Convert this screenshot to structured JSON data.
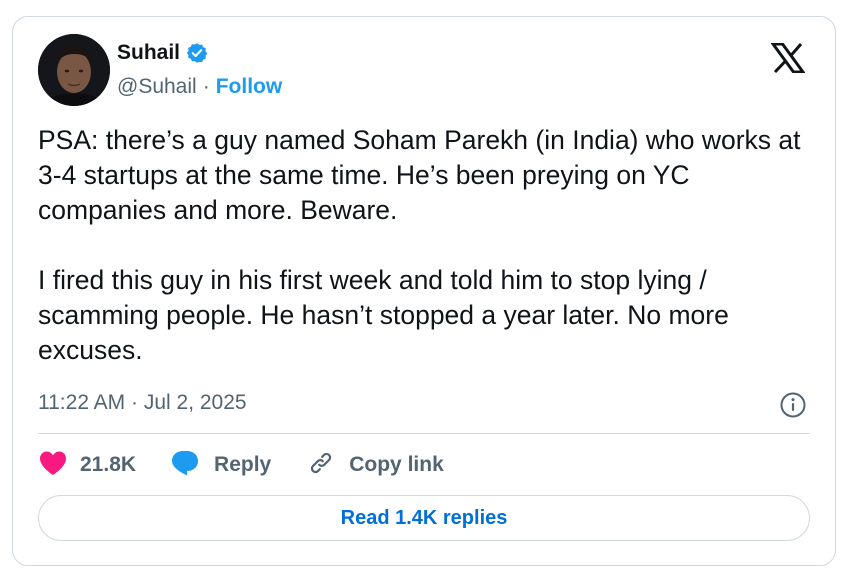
{
  "author": {
    "name": "Suhail",
    "handle": "@Suhail",
    "verified": true,
    "follow_label": "Follow",
    "separator": "·"
  },
  "tweet": {
    "paragraphs": [
      "PSA: there’s a guy named Soham Parekh (in India) who works at 3-4 startups at the same time. He’s been preying on YC companies and more. Beware.",
      "I fired this guy in his first week and told him to stop lying / scamming people. He hasn’t stopped a year later. No more excuses."
    ],
    "timestamp": "11:22 AM · Jul 2, 2025"
  },
  "actions": {
    "likes_count": "21.8K",
    "reply_label": "Reply",
    "copy_link_label": "Copy link"
  },
  "read_replies_label": "Read 1.4K replies",
  "icons": {
    "logo": "x-logo-icon",
    "verified": "verified-badge-icon",
    "info": "info-icon",
    "like": "heart-icon",
    "reply": "speech-bubble-icon",
    "copy": "link-icon"
  },
  "colors": {
    "accent": "#1d9bf0",
    "like": "#f91880",
    "muted": "#536471",
    "text": "#0f1419",
    "border": "#cfd9de",
    "button_text": "#006fd6"
  }
}
